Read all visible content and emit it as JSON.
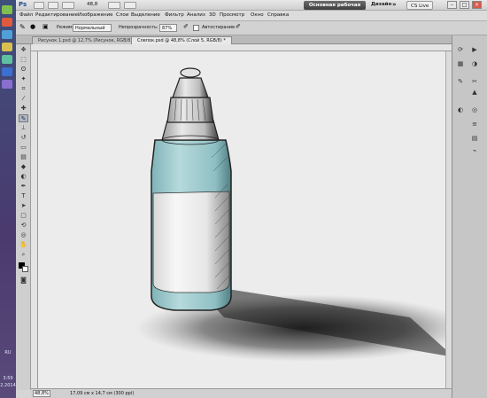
{
  "app": {
    "logo": "Ps",
    "zoom_field": "48,8",
    "workspace_button": "Основная рабочая среда",
    "workspace_design": "Дизайн",
    "workspace_more": "»",
    "cs_live": "CS Live"
  },
  "menu": [
    "Файл",
    "Редактирование",
    "Изображение",
    "Слои",
    "Выделение",
    "Фильтр",
    "Анализ",
    "3D",
    "Просмотр",
    "Окно",
    "Справка"
  ],
  "options_bar": {
    "mode_label": "Режим:",
    "mode_value": "Нормальный",
    "opacity_label": "Непрозрачность:",
    "opacity_value": "87%",
    "autoerase_label": "Автостирание"
  },
  "tabs": [
    {
      "label": "Рисунок 1.psd @ 12,7% (Рисунок, RGB/8)",
      "active": false
    },
    {
      "label": "Слепок.psd @ 48,8% (Слой 5, RGB/8) *",
      "active": true
    }
  ],
  "status": {
    "zoom": "48,8%",
    "doc_info": "17,09 см x 14,7 см (300 ppi)"
  },
  "taskbar": {
    "language": "RU",
    "time": "3:59",
    "date": "2.2014"
  },
  "colors": {
    "liquid": "#a9cfd2",
    "label": "#f2f2f2",
    "canvas_bg": "#ececec",
    "shadow": "#1a1a1a"
  }
}
